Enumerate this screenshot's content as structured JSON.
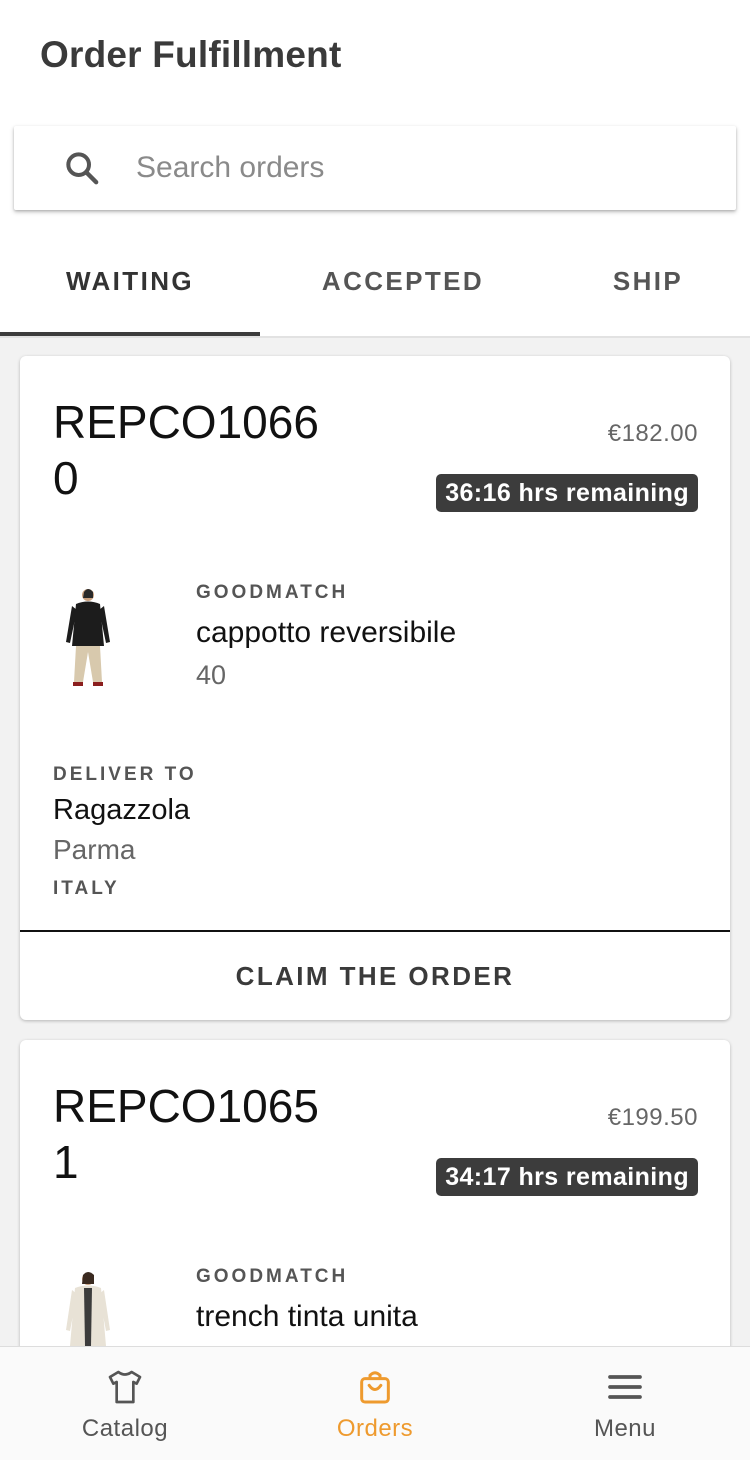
{
  "app": {
    "title": "Order Fulfillment"
  },
  "search": {
    "placeholder": "Search orders",
    "value": "",
    "icon": "search-icon"
  },
  "tabs": [
    {
      "label": "WAITING",
      "active": true
    },
    {
      "label": "ACCEPTED",
      "active": false
    },
    {
      "label": "SHIP",
      "active": false
    }
  ],
  "orders": [
    {
      "order_id": "REPCO10660",
      "price": "€182.00",
      "time_remaining": "36:16 hrs remaining",
      "item": {
        "brand": "GOODMATCH",
        "name": "cappotto reversibile",
        "size": "40"
      },
      "deliver_label": "DELIVER TO",
      "deliver": {
        "name": "Ragazzola",
        "city": "Parma",
        "country": "ITALY"
      },
      "action": "CLAIM THE ORDER"
    },
    {
      "order_id": "REPCO10651",
      "price": "€199.50",
      "time_remaining": "34:17 hrs remaining",
      "item": {
        "brand": "GOODMATCH",
        "name": "trench tinta unita"
      }
    }
  ],
  "bottom_nav": [
    {
      "label": "Catalog",
      "icon": "tshirt-icon",
      "active": false
    },
    {
      "label": "Orders",
      "icon": "shopping-bag-icon",
      "active": true
    },
    {
      "label": "Menu",
      "icon": "hamburger-menu-icon",
      "active": false
    }
  ],
  "colors": {
    "accent": "#ee9a2e",
    "badge_bg": "#3c3c3c",
    "tab_indicator": "#3c3c3c"
  }
}
